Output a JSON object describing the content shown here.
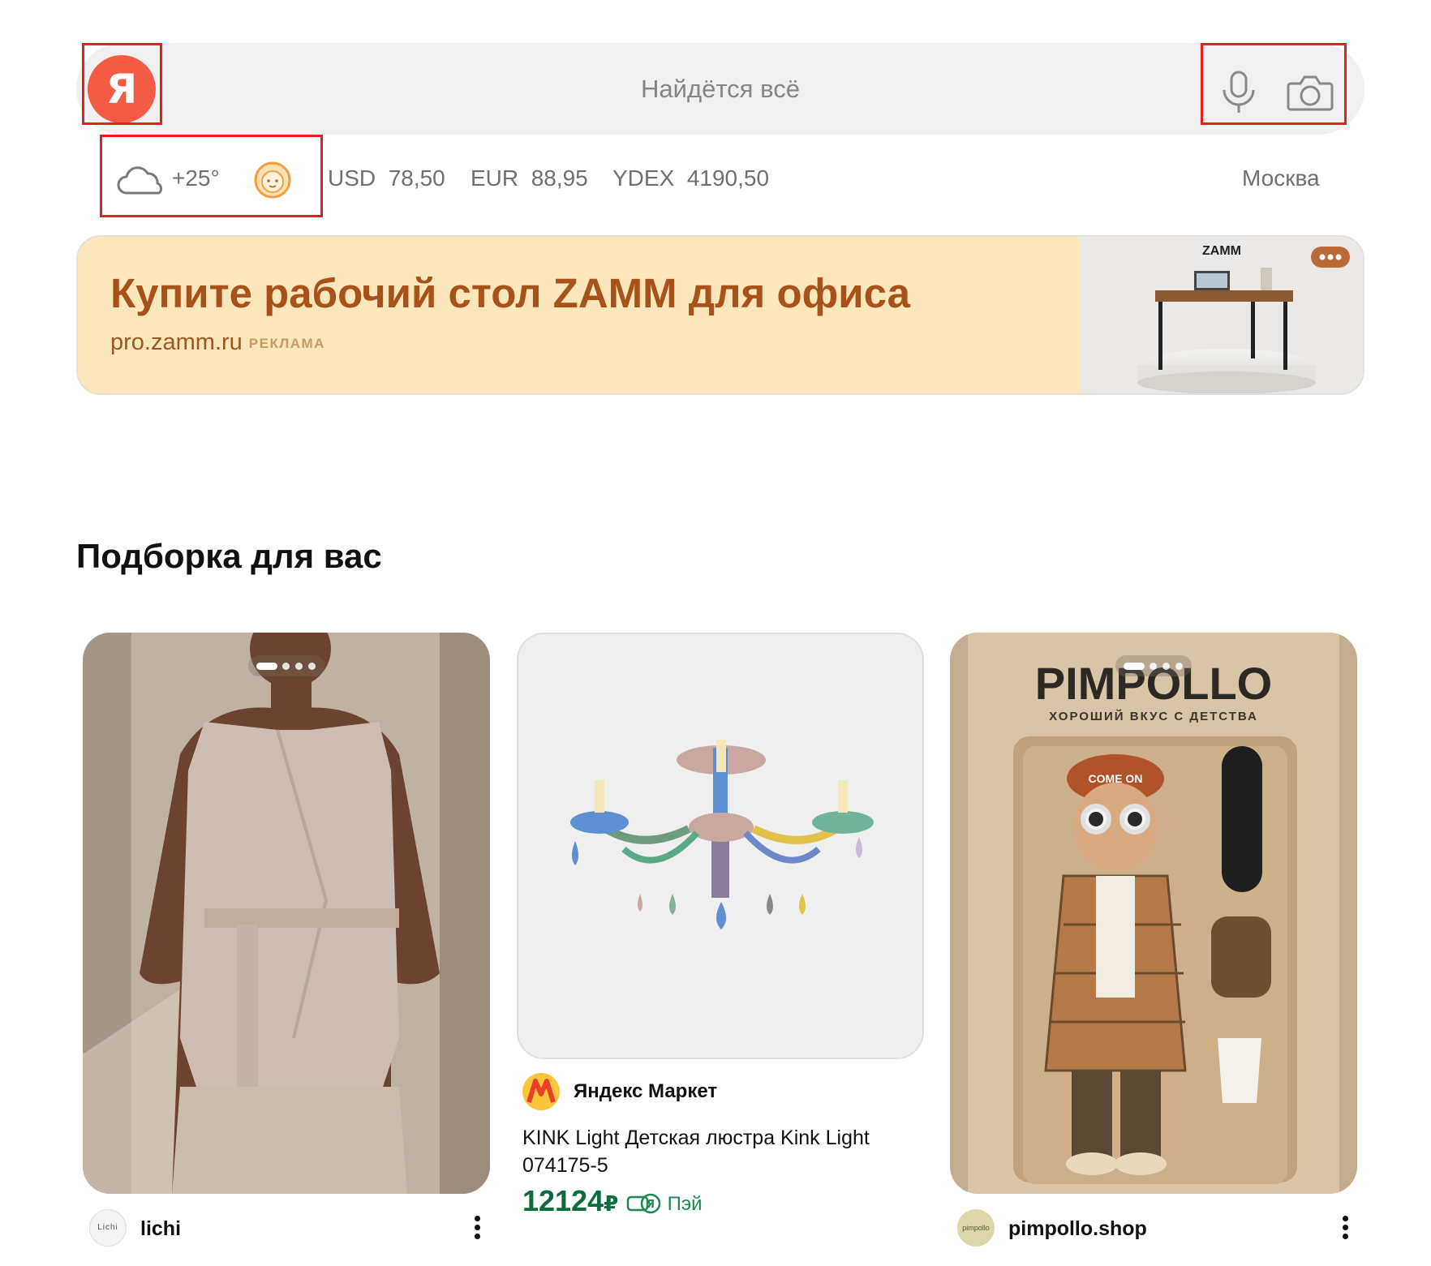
{
  "search": {
    "placeholder": "Найдётся всё",
    "logo_letter": "Я",
    "voice_icon": "microphone-icon",
    "camera_icon": "camera-icon"
  },
  "info_bar": {
    "weather_icon": "cloud-icon",
    "temperature": "+25°",
    "alice_icon": "kid-face-icon",
    "rates": [
      {
        "code": "USD",
        "value": "78,50"
      },
      {
        "code": "EUR",
        "value": "88,95"
      },
      {
        "code": "YDEX",
        "value": "4190,50"
      }
    ],
    "city": "Москва"
  },
  "ad": {
    "title": "Купите рабочий стол ZAMM для офиса",
    "domain": "pro.zamm.ru",
    "tag": "РЕКЛАМА",
    "brand": "ZAMM",
    "more_icon": "more-dots-icon"
  },
  "feed": {
    "title": "Подборка для вас",
    "cards": [
      {
        "source": "lichi",
        "avatar_text": "Lichi"
      },
      {
        "source": "Яндекс Маркет",
        "title": "KINK Light Детская люстра Kink Light 074175-5",
        "price": "12124",
        "currency": "₽",
        "pay_label": "Пэй"
      },
      {
        "source": "pimpollo.shop",
        "avatar_text": "pimpollo",
        "brand": "PIMPOLLO",
        "slogan": "ХОРОШИЙ ВКУС С ДЕТСТВА",
        "cap_text": "COME ON"
      }
    ]
  },
  "colors": {
    "accent_red": "#f45b45",
    "highlight_red": "#e81e1e",
    "ad_background": "#fbe7bb",
    "ad_title": "#a8521b",
    "price_green": "#0e6b3d"
  }
}
